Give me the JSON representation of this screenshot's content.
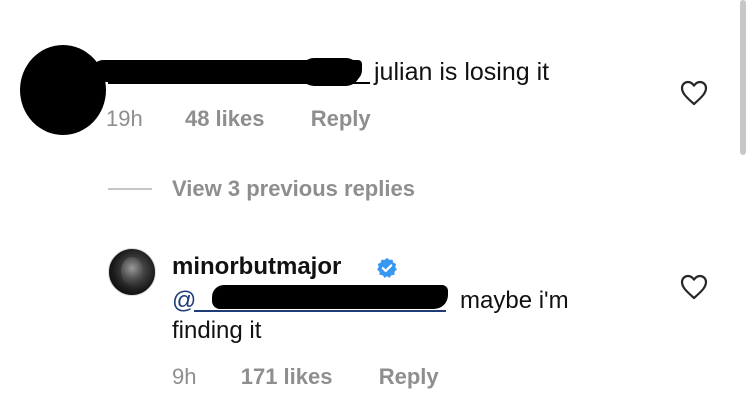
{
  "comment1": {
    "text": "julian is losing it",
    "time": "19h",
    "likes": "48 likes",
    "reply": "Reply"
  },
  "thread": {
    "view_replies": "View 3 previous replies"
  },
  "comment2": {
    "username": "minorbutmajor",
    "mention_prefix": "@",
    "text_line1": "maybe i'm",
    "text_line2": "finding it",
    "time": "9h",
    "likes": "171 likes",
    "reply": "Reply"
  },
  "icons": {
    "like": "heart-outline-icon",
    "verified": "verified-badge-icon"
  },
  "colors": {
    "verified": "#3897f0",
    "meta_text": "#8e8e8e",
    "mention": "#1f3b78"
  }
}
